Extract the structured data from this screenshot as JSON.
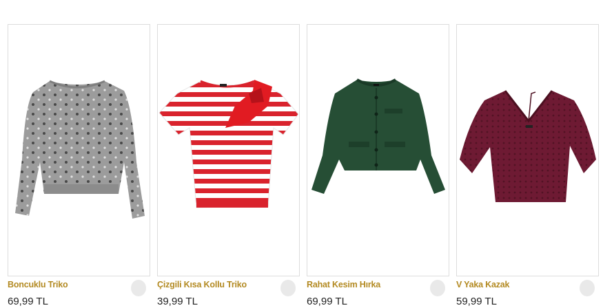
{
  "products": [
    {
      "name": "Boncuklu Triko",
      "price": "69,99 TL",
      "image_icon": "grey-beaded-sweater-image"
    },
    {
      "name": "Çizgili Kısa Kollu Triko",
      "price": "39,99 TL",
      "image_icon": "red-striped-bow-top-image"
    },
    {
      "name": "Rahat Kesim Hırka",
      "price": "69,99 TL",
      "image_icon": "green-cardigan-image"
    },
    {
      "name": "V Yaka Kazak",
      "price": "59,99 TL",
      "image_icon": "burgundy-v-neck-sweater-image"
    }
  ],
  "colors": {
    "product_name": "#b38a22",
    "price": "#222222",
    "image_border": "#dcdcdc"
  }
}
